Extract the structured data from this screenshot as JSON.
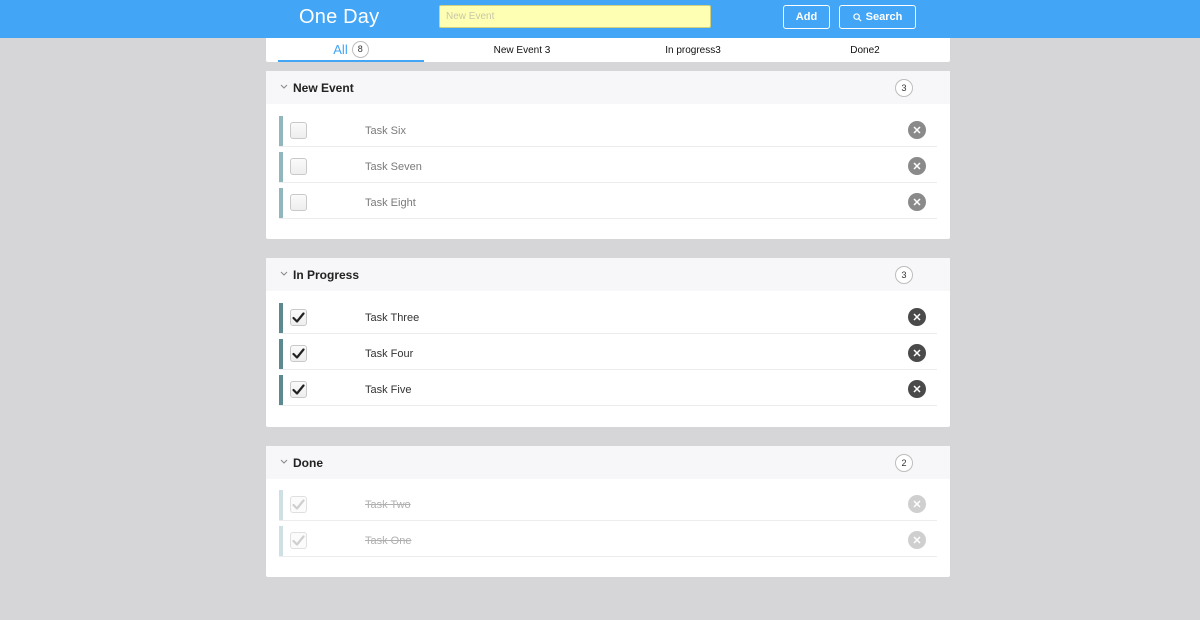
{
  "header": {
    "title": "One Day",
    "input_placeholder": "New Event",
    "add_label": "Add",
    "search_label": "Search"
  },
  "tabs": {
    "all_label": "All",
    "all_count": "8",
    "new_label": "New Event 3",
    "progress_label": "In progress3",
    "done_label": "Done2"
  },
  "groups": {
    "new_event": {
      "title": "New Event",
      "count": "3",
      "tasks": [
        "Task Six",
        "Task Seven",
        "Task Eight"
      ]
    },
    "in_progress": {
      "title": "In Progress",
      "count": "3",
      "tasks": [
        "Task Three",
        "Task Four",
        "Task Five"
      ]
    },
    "done": {
      "title": "Done",
      "count": "2",
      "tasks": [
        "Task Two",
        "Task One"
      ]
    }
  },
  "colors": {
    "accent": "#42a5f5",
    "background": "#d6d5d8",
    "input_bg": "#ffffb3",
    "new_event_bar": "#92b6bd",
    "in_progress_bar": "#5d8a91",
    "done_bar": "#cfe0e4"
  },
  "icons": {
    "group_toggle": "chevron-down-icon",
    "search": "search-icon",
    "delete": "close-circle-icon",
    "check": "checkmark-icon"
  }
}
